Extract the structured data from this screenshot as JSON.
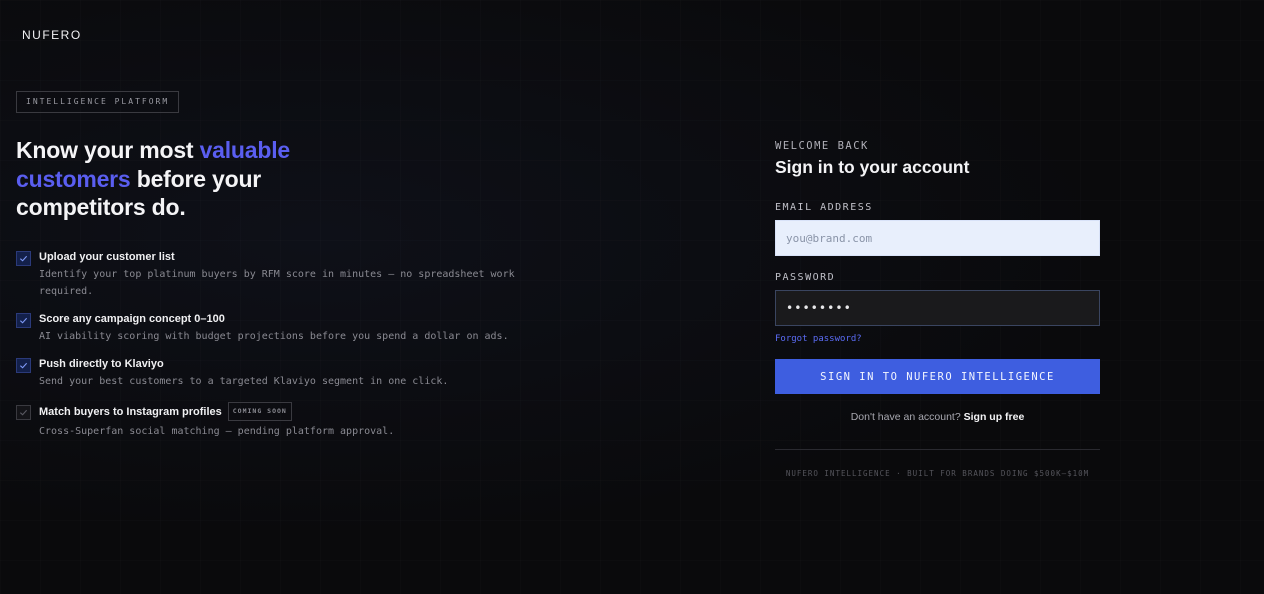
{
  "brand": {
    "logo": "NUFERO"
  },
  "hero": {
    "tag": "INTELLIGENCE PLATFORM",
    "headline_part1": "Know your most ",
    "headline_accent1": "valuable",
    "headline_accent2": "customers",
    "headline_part2": " before your competitors do.",
    "accent_color": "#5a5ef0"
  },
  "features": [
    {
      "title": "Upload your customer list",
      "desc": "Identify your top platinum buyers by RFM score in minutes — no spreadsheet work required."
    },
    {
      "title": "Score any campaign concept 0–100",
      "desc": "AI viability scoring with budget projections before you spend a dollar on ads."
    },
    {
      "title": "Push directly to Klaviyo",
      "desc": "Send your best customers to a targeted Klaviyo segment in one click."
    },
    {
      "title": "Match buyers to Instagram profiles",
      "badge": "COMING SOON",
      "desc": "Cross-Superfan social matching — pending platform approval."
    }
  ],
  "login": {
    "welcome": "WELCOME BACK",
    "title": "Sign in to your account",
    "email_label": "EMAIL ADDRESS",
    "email_placeholder": "you@brand.com",
    "email_value": "",
    "password_label": "PASSWORD",
    "password_value": "••••••••",
    "forgot": "Forgot password?",
    "submit": "SIGN IN TO NUFERO INTELLIGENCE",
    "no_account": "Don't have an account?",
    "signup": "Sign up free",
    "button_color": "#3e5ee0"
  },
  "footer": {
    "text": "NUFERO INTELLIGENCE · BUILT FOR BRANDS DOING $500K–$10M"
  }
}
